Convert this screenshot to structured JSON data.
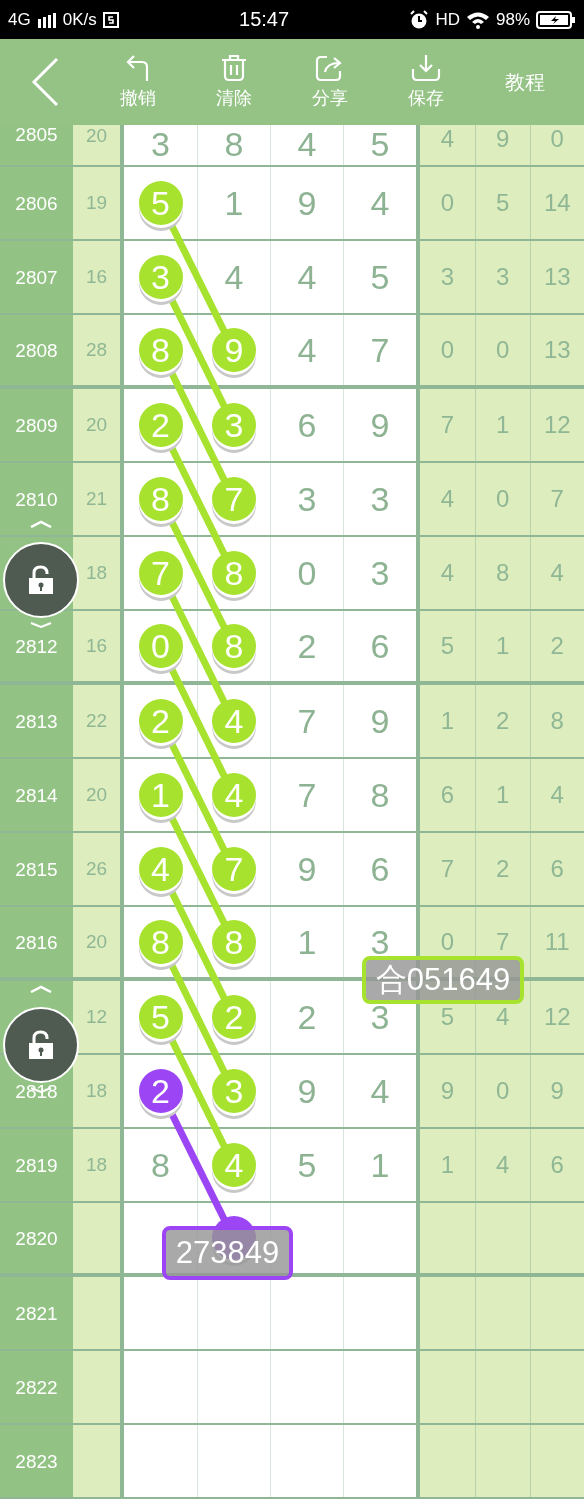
{
  "status_bar": {
    "network": "4G",
    "speed": "0K/s",
    "time": "15:47",
    "hd": "HD",
    "battery": "98%"
  },
  "toolbar": {
    "actions": [
      {
        "kind": "undo",
        "label": "撤销"
      },
      {
        "kind": "trash",
        "label": "清除"
      },
      {
        "kind": "share",
        "label": "分享"
      },
      {
        "kind": "download",
        "label": "保存"
      }
    ],
    "tutorial": "教程"
  },
  "rows": [
    {
      "issue": "2805",
      "sum": "20",
      "digits": [
        {
          "value": "3",
          "marked": false
        },
        {
          "value": "8",
          "marked": false
        },
        {
          "value": "4",
          "marked": false
        },
        {
          "value": "5",
          "marked": false
        }
      ],
      "stats": [
        "4",
        "9",
        "0"
      ]
    },
    {
      "issue": "2806",
      "sum": "19",
      "digits": [
        {
          "value": "5",
          "marked": true,
          "color": "#a6e22e"
        },
        {
          "value": "1",
          "marked": false
        },
        {
          "value": "9",
          "marked": false
        },
        {
          "value": "4",
          "marked": false
        }
      ],
      "stats": [
        "0",
        "5",
        "14"
      ]
    },
    {
      "issue": "2807",
      "sum": "16",
      "digits": [
        {
          "value": "3",
          "marked": true,
          "color": "#a6e22e"
        },
        {
          "value": "4",
          "marked": false
        },
        {
          "value": "4",
          "marked": false
        },
        {
          "value": "5",
          "marked": false
        }
      ],
      "stats": [
        "3",
        "3",
        "13"
      ]
    },
    {
      "issue": "2808",
      "sum": "28",
      "digits": [
        {
          "value": "8",
          "marked": true,
          "color": "#a6e22e"
        },
        {
          "value": "9",
          "marked": true,
          "color": "#a6e22e"
        },
        {
          "value": "4",
          "marked": false
        },
        {
          "value": "7",
          "marked": false
        }
      ],
      "stats": [
        "0",
        "0",
        "13"
      ]
    },
    {
      "issue": "2809",
      "sum": "20",
      "digits": [
        {
          "value": "2",
          "marked": true,
          "color": "#a6e22e"
        },
        {
          "value": "3",
          "marked": true,
          "color": "#a6e22e"
        },
        {
          "value": "6",
          "marked": false
        },
        {
          "value": "9",
          "marked": false
        }
      ],
      "stats": [
        "7",
        "1",
        "12"
      ]
    },
    {
      "issue": "2810",
      "sum": "21",
      "digits": [
        {
          "value": "8",
          "marked": true,
          "color": "#a6e22e"
        },
        {
          "value": "7",
          "marked": true,
          "color": "#a6e22e"
        },
        {
          "value": "3",
          "marked": false
        },
        {
          "value": "3",
          "marked": false
        }
      ],
      "stats": [
        "4",
        "0",
        "7"
      ]
    },
    {
      "sum": "18",
      "digits": [
        {
          "value": "7",
          "marked": true,
          "color": "#a6e22e"
        },
        {
          "value": "8",
          "marked": true,
          "color": "#a6e22e"
        },
        {
          "value": "0",
          "marked": false
        },
        {
          "value": "3",
          "marked": false
        }
      ],
      "stats": [
        "4",
        "8",
        "4"
      ]
    },
    {
      "issue": "2812",
      "sum": "16",
      "digits": [
        {
          "value": "0",
          "marked": true,
          "color": "#a6e22e"
        },
        {
          "value": "8",
          "marked": true,
          "color": "#a6e22e"
        },
        {
          "value": "2",
          "marked": false
        },
        {
          "value": "6",
          "marked": false
        }
      ],
      "stats": [
        "5",
        "1",
        "2"
      ]
    },
    {
      "issue": "2813",
      "sum": "22",
      "digits": [
        {
          "value": "2",
          "marked": true,
          "color": "#a6e22e"
        },
        {
          "value": "4",
          "marked": true,
          "color": "#a6e22e"
        },
        {
          "value": "7",
          "marked": false
        },
        {
          "value": "9",
          "marked": false
        }
      ],
      "stats": [
        "1",
        "2",
        "8"
      ]
    },
    {
      "issue": "2814",
      "sum": "20",
      "digits": [
        {
          "value": "1",
          "marked": true,
          "color": "#a6e22e"
        },
        {
          "value": "4",
          "marked": true,
          "color": "#a6e22e"
        },
        {
          "value": "7",
          "marked": false
        },
        {
          "value": "8",
          "marked": false
        }
      ],
      "stats": [
        "6",
        "1",
        "4"
      ]
    },
    {
      "issue": "2815",
      "sum": "26",
      "digits": [
        {
          "value": "4",
          "marked": true,
          "color": "#a6e22e"
        },
        {
          "value": "7",
          "marked": true,
          "color": "#a6e22e"
        },
        {
          "value": "9",
          "marked": false
        },
        {
          "value": "6",
          "marked": false
        }
      ],
      "stats": [
        "7",
        "2",
        "6"
      ]
    },
    {
      "issue": "2816",
      "sum": "20",
      "digits": [
        {
          "value": "8",
          "marked": true,
          "color": "#a6e22e"
        },
        {
          "value": "8",
          "marked": true,
          "color": "#a6e22e"
        },
        {
          "value": "1",
          "marked": false
        },
        {
          "value": "3",
          "marked": false
        }
      ],
      "stats": [
        "0",
        "7",
        "11"
      ]
    },
    {
      "sum": "12",
      "digits": [
        {
          "value": "5",
          "marked": true,
          "color": "#a6e22e"
        },
        {
          "value": "2",
          "marked": true,
          "color": "#a6e22e"
        },
        {
          "value": "2",
          "marked": false
        },
        {
          "value": "3",
          "marked": false
        }
      ],
      "stats": [
        "5",
        "4",
        "12"
      ]
    },
    {
      "issue": "2818",
      "sum": "18",
      "digits": [
        {
          "value": "2",
          "marked": true,
          "color": "#9b45f5"
        },
        {
          "value": "3",
          "marked": true,
          "color": "#a6e22e"
        },
        {
          "value": "9",
          "marked": false
        },
        {
          "value": "4",
          "marked": false
        }
      ],
      "stats": [
        "9",
        "0",
        "9"
      ]
    },
    {
      "issue": "2819",
      "sum": "18",
      "digits": [
        {
          "value": "8",
          "marked": false
        },
        {
          "value": "4",
          "marked": true,
          "color": "#a6e22e"
        },
        {
          "value": "5",
          "marked": false
        },
        {
          "value": "1",
          "marked": false
        }
      ],
      "stats": [
        "1",
        "4",
        "6"
      ]
    },
    {
      "issue": "2820",
      "digits": [
        {
          "marked": false
        },
        {
          "marked": true,
          "color": "#9b45f5"
        },
        {
          "marked": false
        },
        {
          "marked": false
        }
      ],
      "stats": []
    },
    {
      "issue": "2821",
      "digits": [
        {
          "marked": false
        },
        {
          "marked": false
        },
        {
          "marked": false
        },
        {
          "marked": false
        }
      ],
      "stats": []
    },
    {
      "issue": "2822",
      "digits": [
        {
          "marked": false
        },
        {
          "marked": false
        },
        {
          "marked": false
        },
        {
          "marked": false
        }
      ],
      "stats": []
    },
    {
      "issue": "2823",
      "digits": [
        {
          "marked": false
        },
        {
          "marked": false
        },
        {
          "marked": false
        },
        {
          "marked": false
        }
      ],
      "stats": []
    }
  ],
  "callouts": [
    {
      "text": "合051649",
      "color": "#a6e22e"
    },
    {
      "text": "273849",
      "color": "#9b45f5"
    }
  ]
}
